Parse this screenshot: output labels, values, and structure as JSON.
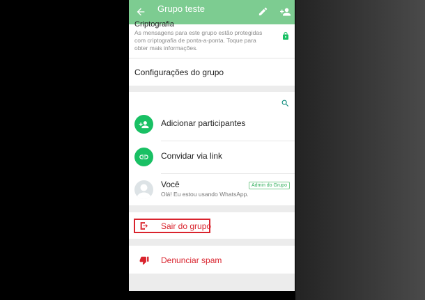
{
  "header": {
    "title": "Grupo teste",
    "bg_color": "#7dcc91",
    "icons": [
      "back-arrow-icon",
      "pencil-icon",
      "add-person-icon"
    ]
  },
  "encryption": {
    "heading": "Criptografia",
    "description": "As mensagens para este grupo estão protegidas com criptografia de ponta-a-ponta. Toque para obter mais informações."
  },
  "settings": {
    "label": "Configurações do grupo"
  },
  "participants": {
    "add_label": "Adicionar participantes",
    "invite_label": "Convidar via link",
    "members": [
      {
        "name": "Você",
        "status": "Olá! Eu estou usando WhatsApp.",
        "badge": "Admin do Grupo"
      }
    ]
  },
  "actions": {
    "leave_label": "Sair do grupo",
    "report_label": "Denunciar spam",
    "danger_color": "#d9232d",
    "accent_color": "#19c064"
  }
}
